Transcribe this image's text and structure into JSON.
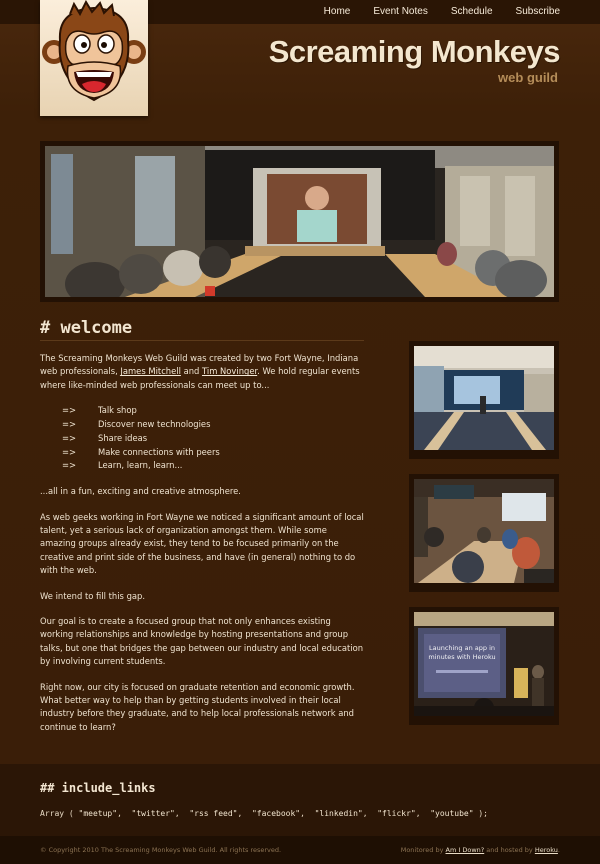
{
  "nav": {
    "items": [
      {
        "label": "Home"
      },
      {
        "label": "Event Notes"
      },
      {
        "label": "Schedule"
      },
      {
        "label": "Subscribe"
      }
    ]
  },
  "header": {
    "title": "Screaming Monkeys",
    "subtitle": "web guild"
  },
  "welcome": {
    "heading": "# welcome",
    "intro_1": "The Screaming Monkeys Web Guild was created by two Fort Wayne, Indiana web professionals, ",
    "founder_1": "James Mitchell",
    "and": " and ",
    "founder_2": "Tim Novinger",
    "intro_2": ". We hold regular events where like-minded web professionals can meet up to...",
    "bullet_arrow": "=>",
    "bullets": [
      "Talk shop",
      "Discover new technologies",
      "Share ideas",
      "Make connections with peers",
      "Learn, learn, learn..."
    ],
    "p_atmosphere": "...all in a fun, exciting and creative atmosphere.",
    "p_geeks": "As web geeks working in Fort Wayne we noticed a significant amount of local talent, yet a serious lack of organization amongst them. While some amazing groups already exist, they tend to be focused primarily on the creative and print side of the business, and have (in general) nothing to do with the web.",
    "p_fill": "We intend to fill this gap.",
    "p_goal": "Our goal is to create a focused group that not only enhances existing working relationships and knowledge by hosting presentations and group talks, but one that bridges the gap between our industry and local education by involving current students.",
    "p_now": "Right now, our city is focused on graduate retention and economic growth. What better way to help than by getting students involved in their local industry before they graduate, and to help local professionals network and continue to learn?"
  },
  "slide_text": {
    "line1": "Launching an app in",
    "line2": "minutes with Heroku"
  },
  "links": {
    "heading": "## include_links",
    "prefix": "Array ( ",
    "suffix": " );",
    "items": [
      "\"meetup\"",
      "\"twitter\"",
      "\"rss feed\"",
      "\"facebook\"",
      "\"linkedin\"",
      "\"flickr\"",
      "\"youtube\""
    ]
  },
  "footer": {
    "copyright": "© Copyright 2010 The Screaming Monkeys Web Guild. All rights reserved.",
    "monitored": "Monitored by ",
    "monitor_link": "Am I Down?",
    "hosted": " and hosted by ",
    "host_link": "Heroku",
    "end": "."
  },
  "colors": {
    "background": "#3b1f08",
    "topbar": "#2a1505",
    "footer": "#2b1606",
    "text": "#efe3d0"
  }
}
